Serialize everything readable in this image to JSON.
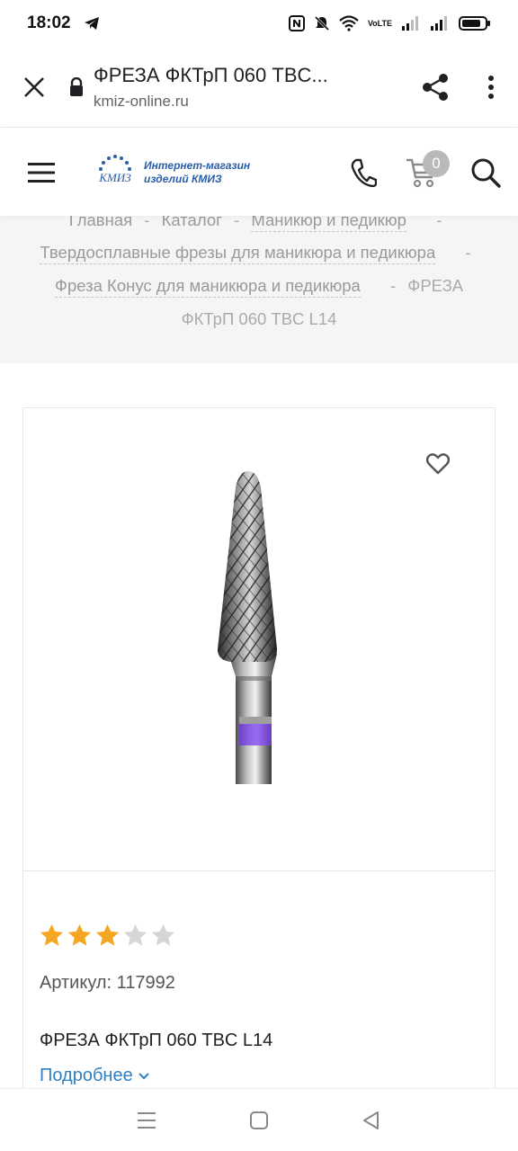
{
  "status_bar": {
    "time": "18:02",
    "network_label": "VoLTE"
  },
  "browser": {
    "page_title": "ФРЕЗА ФКТрП 060 TBC...",
    "url": "kmiz-online.ru"
  },
  "site_header": {
    "logo_line1": "Интернет-магазин",
    "logo_line2": "изделий КМИЗ",
    "logo_mark_text": "КМИЗ",
    "cart_count": "0"
  },
  "breadcrumbs": {
    "items": [
      {
        "label": "Главная"
      },
      {
        "label": "Каталог"
      },
      {
        "label": "Маникюр и педикюр"
      },
      {
        "label": "Твердосплавные фрезы для маникюра и педикюра"
      },
      {
        "label": "Фреза Конус для маникюра и педикюра"
      }
    ],
    "current_part1": "ФРЕЗА",
    "current_part2": "ФКТрП 060 TBC L14",
    "separator": "-"
  },
  "product": {
    "rating": 3,
    "rating_max": 5,
    "article": "Артикул: 117992",
    "name": "ФРЕЗА ФКТрП 060 TBC L14",
    "more_label": "Подробнее"
  },
  "colors": {
    "accent_link": "#2f7fc1",
    "star_on": "#f5a623",
    "star_off": "#d6d6d6",
    "band": "#7a3ff0",
    "logo_blue": "#2a5ea8"
  }
}
